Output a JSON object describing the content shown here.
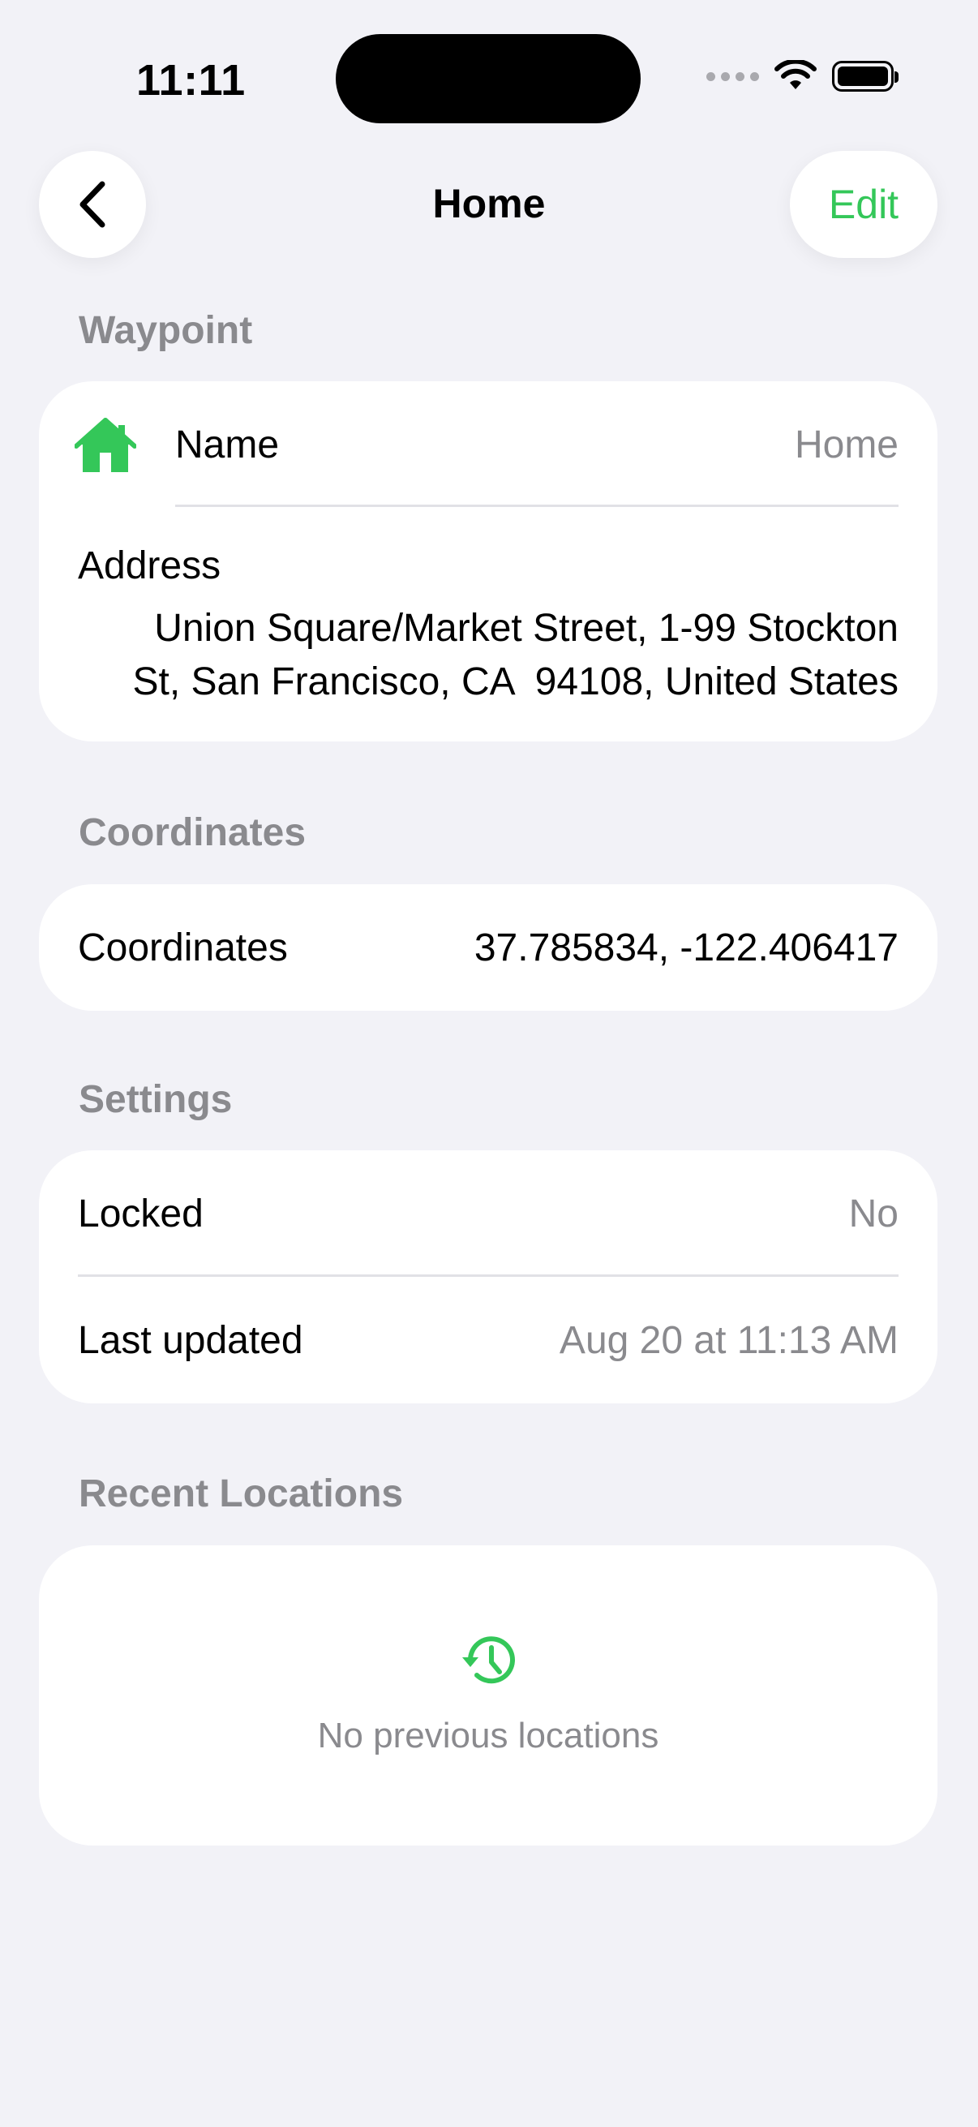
{
  "status_bar": {
    "time": "11:11"
  },
  "nav": {
    "title": "Home",
    "edit_label": "Edit"
  },
  "colors": {
    "accent": "#34c759",
    "background": "#f2f2f7",
    "secondary_text": "#8a8a8e"
  },
  "waypoint": {
    "header": "Waypoint",
    "name_label": "Name",
    "name_value": "Home",
    "address_label": "Address",
    "address_line1": "Union Square/Market Street, 1-99 Stockton",
    "address_line2": "St, San Francisco, CA  94108, United States",
    "icon": "house-icon"
  },
  "coordinates": {
    "header": "Coordinates",
    "label": "Coordinates",
    "value": "37.785834, -122.406417"
  },
  "settings": {
    "header": "Settings",
    "locked_label": "Locked",
    "locked_value": "No",
    "updated_label": "Last updated",
    "updated_value": "Aug 20 at 11:13 AM"
  },
  "recent": {
    "header": "Recent Locations",
    "empty_text": "No previous locations",
    "icon": "history-icon"
  }
}
